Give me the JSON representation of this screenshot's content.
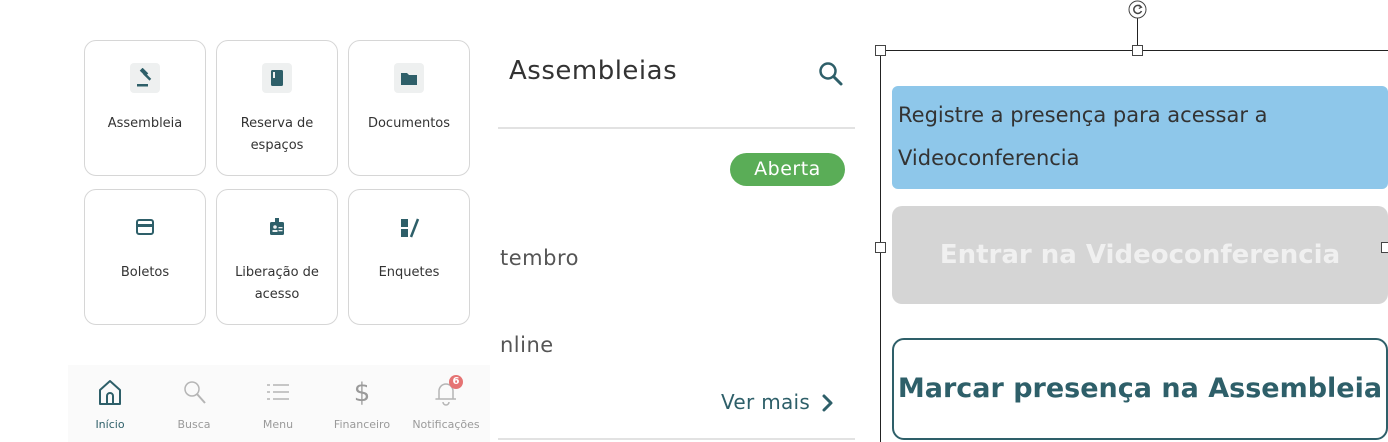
{
  "grid": {
    "tiles": [
      {
        "label": "Assembleia",
        "icon": "gavel-icon"
      },
      {
        "label": "Reserva de espaços",
        "icon": "book-icon"
      },
      {
        "label": "Documentos",
        "icon": "folder-icon"
      },
      {
        "label": "Boletos",
        "icon": "credit-card-icon"
      },
      {
        "label": "Liberação de acesso",
        "icon": "id-badge-icon"
      },
      {
        "label": "Enquetes",
        "icon": "poll-icon"
      }
    ]
  },
  "bottom_nav": {
    "items": [
      {
        "label": "Início",
        "icon": "home-icon",
        "active": true
      },
      {
        "label": "Busca",
        "icon": "search-icon",
        "active": false
      },
      {
        "label": "Menu",
        "icon": "menu-icon",
        "active": false
      },
      {
        "label": "Financeiro",
        "icon": "dollar-icon",
        "active": false
      },
      {
        "label": "Notificações",
        "icon": "bell-icon",
        "active": false
      }
    ],
    "notification_count": "6"
  },
  "assembleias": {
    "title": "Assembleias",
    "status_badge": "Aberta",
    "date_fragment": "tembro",
    "mode_fragment": "nline",
    "see_more": "Ver mais"
  },
  "video_panel": {
    "message_line1": "Registre a presença para acessar a",
    "message_line2": "Videoconferencia",
    "enter_button": "Entrar na Videoconferencia",
    "mark_presence_button": "Marcar presença na Assembleia"
  },
  "colors": {
    "primary": "#2e5f69",
    "badge_green": "#5aad57",
    "info_blue": "#8ec7ea",
    "disabled_gray": "#d5d5d5",
    "notification_red": "#e57373"
  }
}
